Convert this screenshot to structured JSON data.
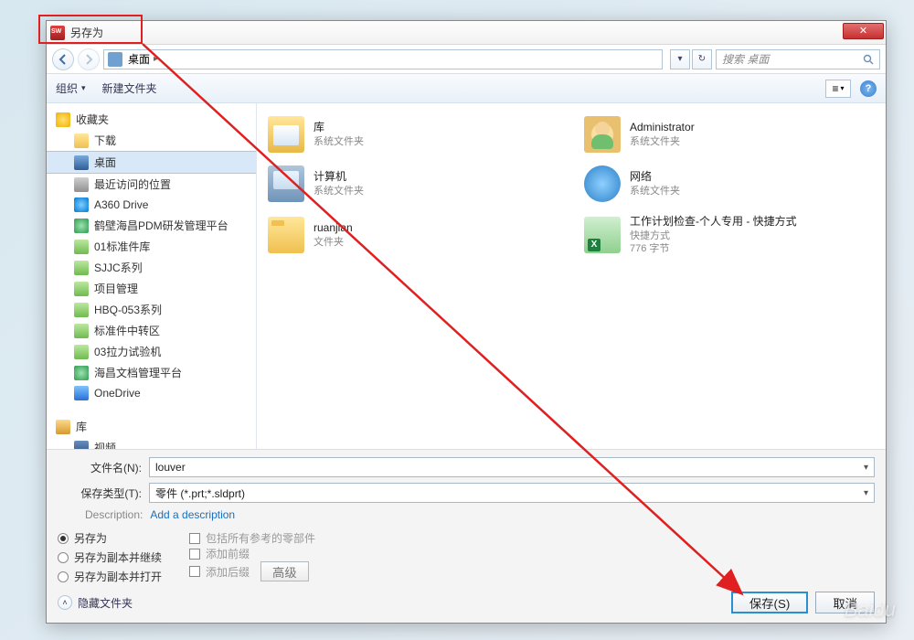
{
  "titlebar": {
    "title": "另存为",
    "close": "✕"
  },
  "nav": {
    "location": "桌面",
    "dropdown_arrow": "▾",
    "crumb_arrow": "▸",
    "refresh": "↻",
    "search_placeholder": "搜索 桌面"
  },
  "toolbar": {
    "organize": "组织",
    "organize_arrow": "▾",
    "newfolder": "新建文件夹",
    "view_icon": "≡",
    "help": "?"
  },
  "sidebar": {
    "favorites_label": "收藏夹",
    "items_fav": [
      {
        "label": "下载",
        "icon": "ic-folder"
      },
      {
        "label": "桌面",
        "icon": "ic-desktop",
        "selected": true
      },
      {
        "label": "最近访问的位置",
        "icon": "ic-recent"
      },
      {
        "label": "A360 Drive",
        "icon": "ic-a360"
      },
      {
        "label": "鹤壁海昌PDM研发管理平台",
        "icon": "ic-globe"
      },
      {
        "label": "01标准件库",
        "icon": "ic-greenf"
      },
      {
        "label": "SJJC系列",
        "icon": "ic-greenf"
      },
      {
        "label": "项目管理",
        "icon": "ic-greenf"
      },
      {
        "label": "HBQ-053系列",
        "icon": "ic-greenf"
      },
      {
        "label": "标准件中转区",
        "icon": "ic-greenf"
      },
      {
        "label": "03拉力试验机",
        "icon": "ic-greenf"
      },
      {
        "label": "海昌文档管理平台",
        "icon": "ic-globe"
      },
      {
        "label": "OneDrive",
        "icon": "ic-od"
      }
    ],
    "lib_label": "库",
    "items_lib": [
      {
        "label": "视频",
        "icon": "ic-video"
      }
    ]
  },
  "content": {
    "items": [
      {
        "name": "库",
        "sub": "系统文件夹",
        "icon": "i-lib"
      },
      {
        "name": "Administrator",
        "sub": "系统文件夹",
        "icon": "i-user"
      },
      {
        "name": "计算机",
        "sub": "系统文件夹",
        "icon": "i-computer"
      },
      {
        "name": "网络",
        "sub": "系统文件夹",
        "icon": "i-network"
      },
      {
        "name": "ruanjian",
        "sub": "文件夹",
        "icon": "i-folder"
      },
      {
        "name": "工作计划检查-个人专用 - 快捷方式",
        "sub": "快捷方式",
        "sub2": "776 字节",
        "icon": "i-xls"
      }
    ]
  },
  "footer": {
    "filename_label": "文件名(N):",
    "filename_value": "louver",
    "filetype_label": "保存类型(T):",
    "filetype_value": "零件 (*.prt;*.sldprt)",
    "desc_label": "Description:",
    "desc_link": "Add a description",
    "radios": [
      {
        "label": "另存为",
        "on": true
      },
      {
        "label": "另存为副本并继续",
        "on": false
      },
      {
        "label": "另存为副本并打开",
        "on": false
      }
    ],
    "checks": [
      {
        "label": "包括所有参考的零部件",
        "enabled": false
      },
      {
        "label": "添加前缀",
        "enabled": false
      },
      {
        "label": "添加后缀",
        "enabled": false
      }
    ],
    "advanced_btn": "高级",
    "hide_folders": "隐藏文件夹",
    "save_btn": "保存(S)",
    "cancel_btn": "取消"
  },
  "watermark": "Baidu"
}
